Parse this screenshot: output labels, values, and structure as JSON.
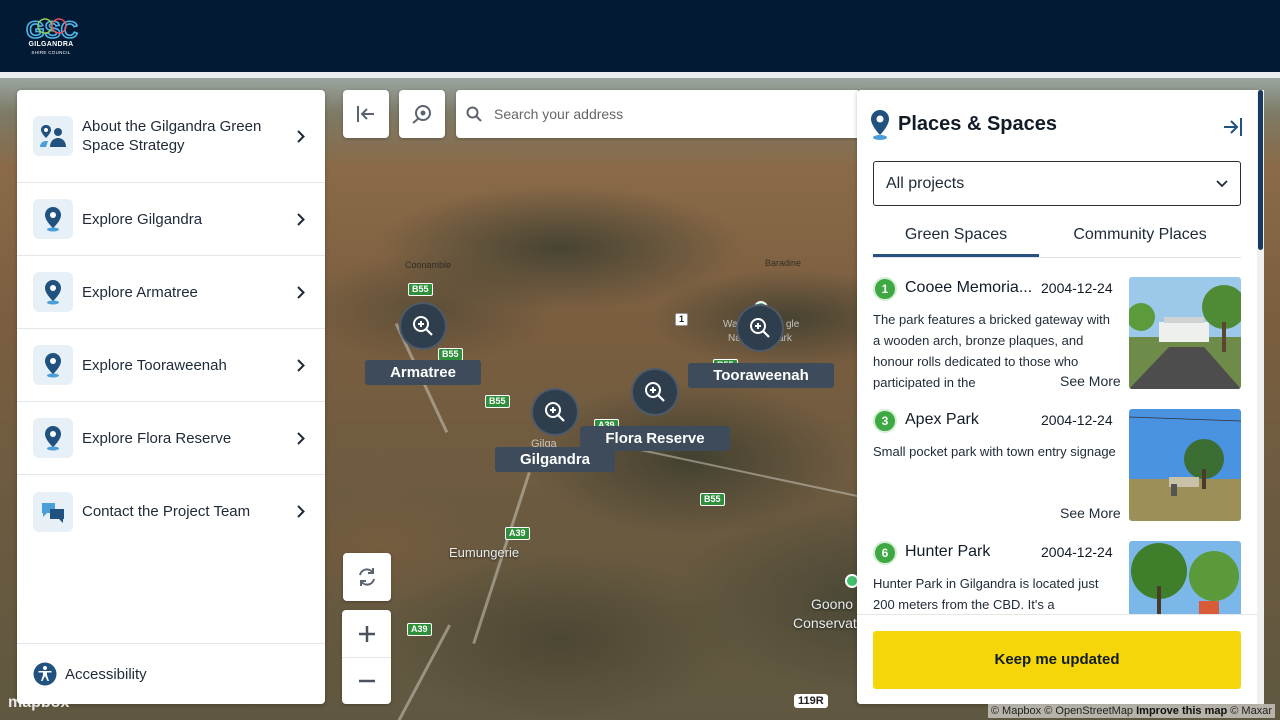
{
  "header": {
    "logo_mark": "GSC",
    "logo_name": "GILGANDRA",
    "logo_sub": "SHIRE COUNCIL"
  },
  "sidebar": {
    "items": [
      {
        "label": "About the Gilgandra Green Space Strategy",
        "icon": "people-map-icon"
      },
      {
        "label": "Explore Gilgandra",
        "icon": "location-pin-icon"
      },
      {
        "label": "Explore Armatree",
        "icon": "location-pin-icon"
      },
      {
        "label": "Explore Tooraweenah",
        "icon": "location-pin-icon"
      },
      {
        "label": "Explore Flora Reserve",
        "icon": "location-pin-icon"
      },
      {
        "label": "Contact the Project Team",
        "icon": "chat-bubbles-icon"
      }
    ],
    "footer": {
      "label": "Accessibility",
      "icon": "accessibility-icon"
    }
  },
  "search": {
    "placeholder": "Search your address"
  },
  "map": {
    "markers": [
      {
        "label": "Armatree"
      },
      {
        "label": "Gilgandra"
      },
      {
        "label": "Flora Reserve"
      },
      {
        "label": "Tooraweenah"
      }
    ],
    "place_labels": [
      "Coonamble",
      "Baradine",
      "Eumungerie",
      "Goono",
      "Conservat",
      "Gilga",
      "Wa",
      "gle",
      "Na",
      "ark"
    ],
    "road_shields": [
      "B55",
      "B55",
      "B55",
      "B55",
      "A39",
      "A39",
      "A39",
      "B55",
      "1"
    ],
    "route_tag": "119R",
    "attribution": {
      "mapbox": "© Mapbox",
      "osm": "© OpenStreetMap",
      "improve": "Improve this map",
      "maxar": "© Maxar"
    },
    "mapbox_logo": "mapbox"
  },
  "panel": {
    "title": "Places & Spaces",
    "filter": {
      "selected": "All projects"
    },
    "tabs": [
      {
        "label": "Green Spaces",
        "active": true
      },
      {
        "label": "Community Places",
        "active": false
      }
    ],
    "cards": [
      {
        "number": "1",
        "title": "Cooee Memoria...",
        "date": "2004-12-24",
        "description": "The park features a bricked gateway with a wooden arch, bronze plaques, and honour rolls dedicated to those who participated in the",
        "more": "See More"
      },
      {
        "number": "3",
        "title": "Apex Park",
        "date": "2004-12-24",
        "description": "Small pocket park with town entry signage",
        "more": "See More"
      },
      {
        "number": "6",
        "title": "Hunter Park",
        "date": "2004-12-24",
        "description": "Hunter Park in Gilgandra is located just 200 meters from the CBD. It's a",
        "more": ""
      }
    ],
    "cta": "Keep me updated"
  },
  "colors": {
    "header_bg": "#031a35",
    "accent_yellow": "#f5d60a",
    "tab_active": "#27527f",
    "badge_green": "#3ea843",
    "marker_bg": "#2f3e4d"
  }
}
